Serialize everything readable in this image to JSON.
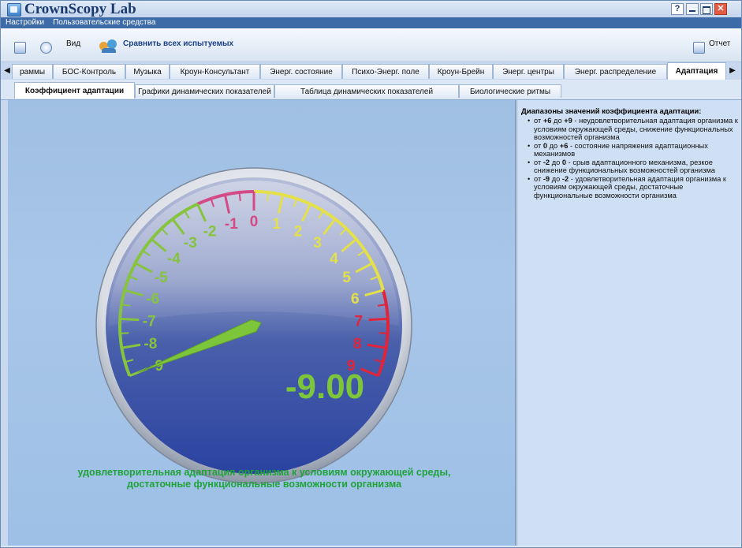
{
  "window": {
    "title": "CrownScopy Lab",
    "help_label": "?"
  },
  "menu": {
    "items": [
      "Настройки",
      "Пользовательские средства"
    ]
  },
  "toolbar": {
    "view_label": "Вид",
    "compare_label": "Сравнить всех испытуемых",
    "report_label": "Отчет"
  },
  "tabs_main": [
    "раммы",
    "БОС-Контроль",
    "Музыка",
    "Кроун-Консультант",
    "Энерг. состояние",
    "Психо-Энерг. поле",
    "Кроун-Брейн",
    "Энерг. центры",
    "Энерг. распределение",
    "Адаптация"
  ],
  "tabs_main_active": "Адаптация",
  "tabs_sub": [
    "Коэффициент адаптации",
    "Графики динамических показателей",
    "Таблица динамических показателей",
    "Биологические ритмы"
  ],
  "tabs_sub_active": "Коэффициент адаптации",
  "gauge": {
    "value": -9.0,
    "value_label": "-9.00",
    "min": -9,
    "max": 9,
    "tick_labels": [
      "-9",
      "-8",
      "-7",
      "-6",
      "-5",
      "-4",
      "-3",
      "-2",
      "-1",
      "0",
      "1",
      "2",
      "3",
      "4",
      "5",
      "6",
      "7",
      "8",
      "9"
    ],
    "colors": {
      "green": "#86c33e",
      "pink": "#d44a86",
      "yellow": "#e3e04a",
      "red": "#e0243a",
      "value": "#7dc63b"
    }
  },
  "caption": {
    "line1": "удовлетворительная адаптация организма к условиям окружающей среды,",
    "line2": "достаточные функциональные возможности организма"
  },
  "legend": {
    "title": "Диапазоны значений коэффициента адаптации:",
    "items": [
      {
        "range_from": "+6",
        "range_to": "+9",
        "text": "неудовлетворительная адаптация организма к условиям окружающей среды, снижение функциональных возможностей организма"
      },
      {
        "range_from": "0",
        "range_to": "+6",
        "text": "состояние напряжения адаптационных механизмов"
      },
      {
        "range_from": "-2",
        "range_to": "0",
        "text": "срыв адаптационного механизма, резкое снижение функциональных возможностей организма"
      },
      {
        "range_from": "-9",
        "range_to": "-2",
        "text": "удовлетворительная адаптация организма к условиям окружающей среды, достаточные функциональные возможности организма"
      }
    ],
    "from_word": "от",
    "to_word": "до"
  }
}
